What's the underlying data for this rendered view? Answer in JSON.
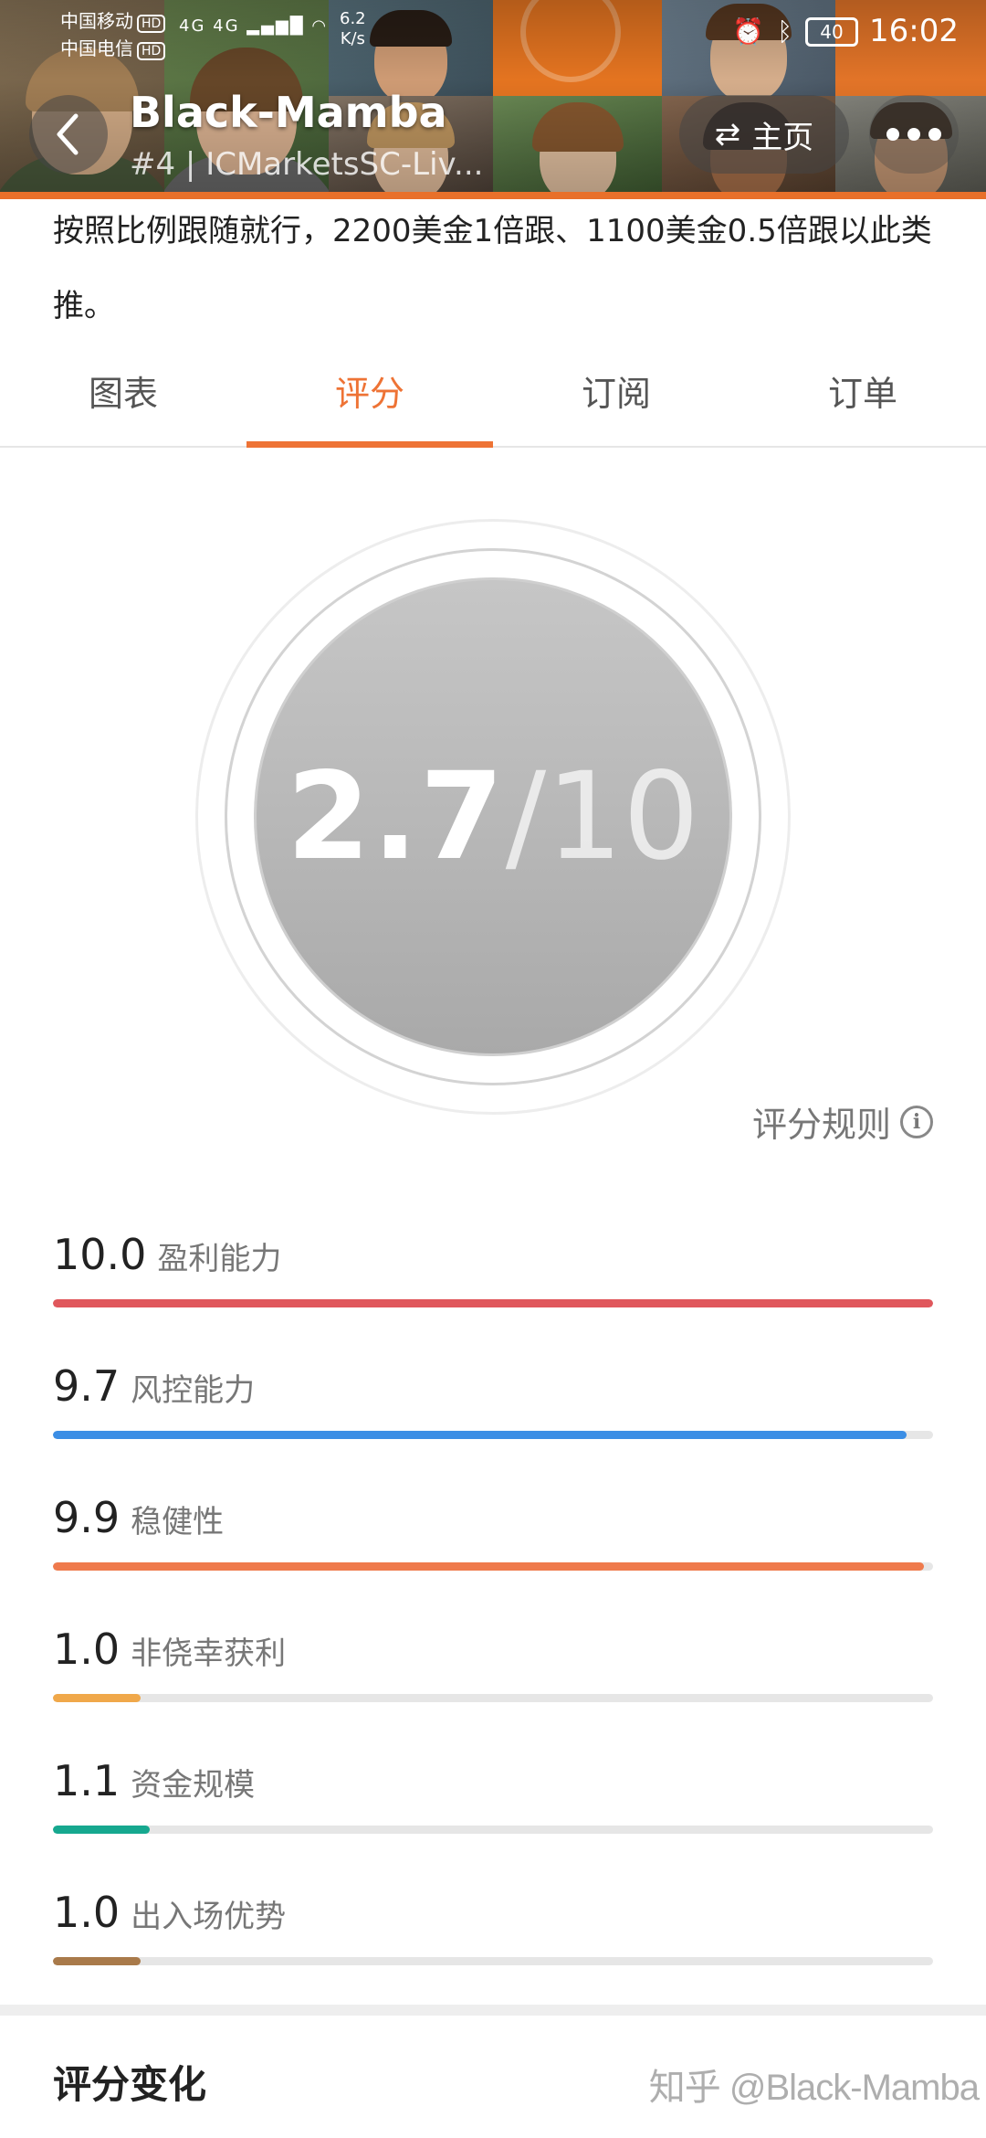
{
  "status_bar": {
    "carrier1": "中国移动",
    "carrier2": "中国电信",
    "hd": "HD",
    "signal": "4G 4G",
    "net_speed_value": "6.2",
    "net_speed_unit": "K/s",
    "battery": "40",
    "time": "16:02"
  },
  "header": {
    "title": "Black-Mamba",
    "subtitle": "#4 | ICMarketsSC-Liv...",
    "home_label": "主页"
  },
  "description": "按照比例跟随就行，2200美金1倍跟、1100美金0.5倍跟以此类推。",
  "tabs": [
    {
      "label": "图表"
    },
    {
      "label": "评分"
    },
    {
      "label": "订阅"
    },
    {
      "label": "订单"
    }
  ],
  "active_tab": "评分",
  "score": {
    "value": "2.7",
    "max": "/10"
  },
  "rules_label": "评分规则",
  "metrics": [
    {
      "value": "10.0",
      "name": "盈利能力",
      "ratio": 1.0,
      "color": "#e0575c"
    },
    {
      "value": "9.7",
      "name": "风控能力",
      "ratio": 0.97,
      "color": "#3b8ee5"
    },
    {
      "value": "9.9",
      "name": "稳健性",
      "ratio": 0.99,
      "color": "#ef7a4c"
    },
    {
      "value": "1.0",
      "name": "非侥幸获利",
      "ratio": 0.1,
      "color": "#f0a84a"
    },
    {
      "value": "1.1",
      "name": "资金规模",
      "ratio": 0.11,
      "color": "#16a88f"
    },
    {
      "value": "1.0",
      "name": "出入场优势",
      "ratio": 0.1,
      "color": "#a97a4a"
    }
  ],
  "section_title": "评分变化",
  "watermark": "知乎 @Black-Mamba",
  "colors": {
    "accent": "#ee7335",
    "header_stripe": "#e8702a"
  }
}
